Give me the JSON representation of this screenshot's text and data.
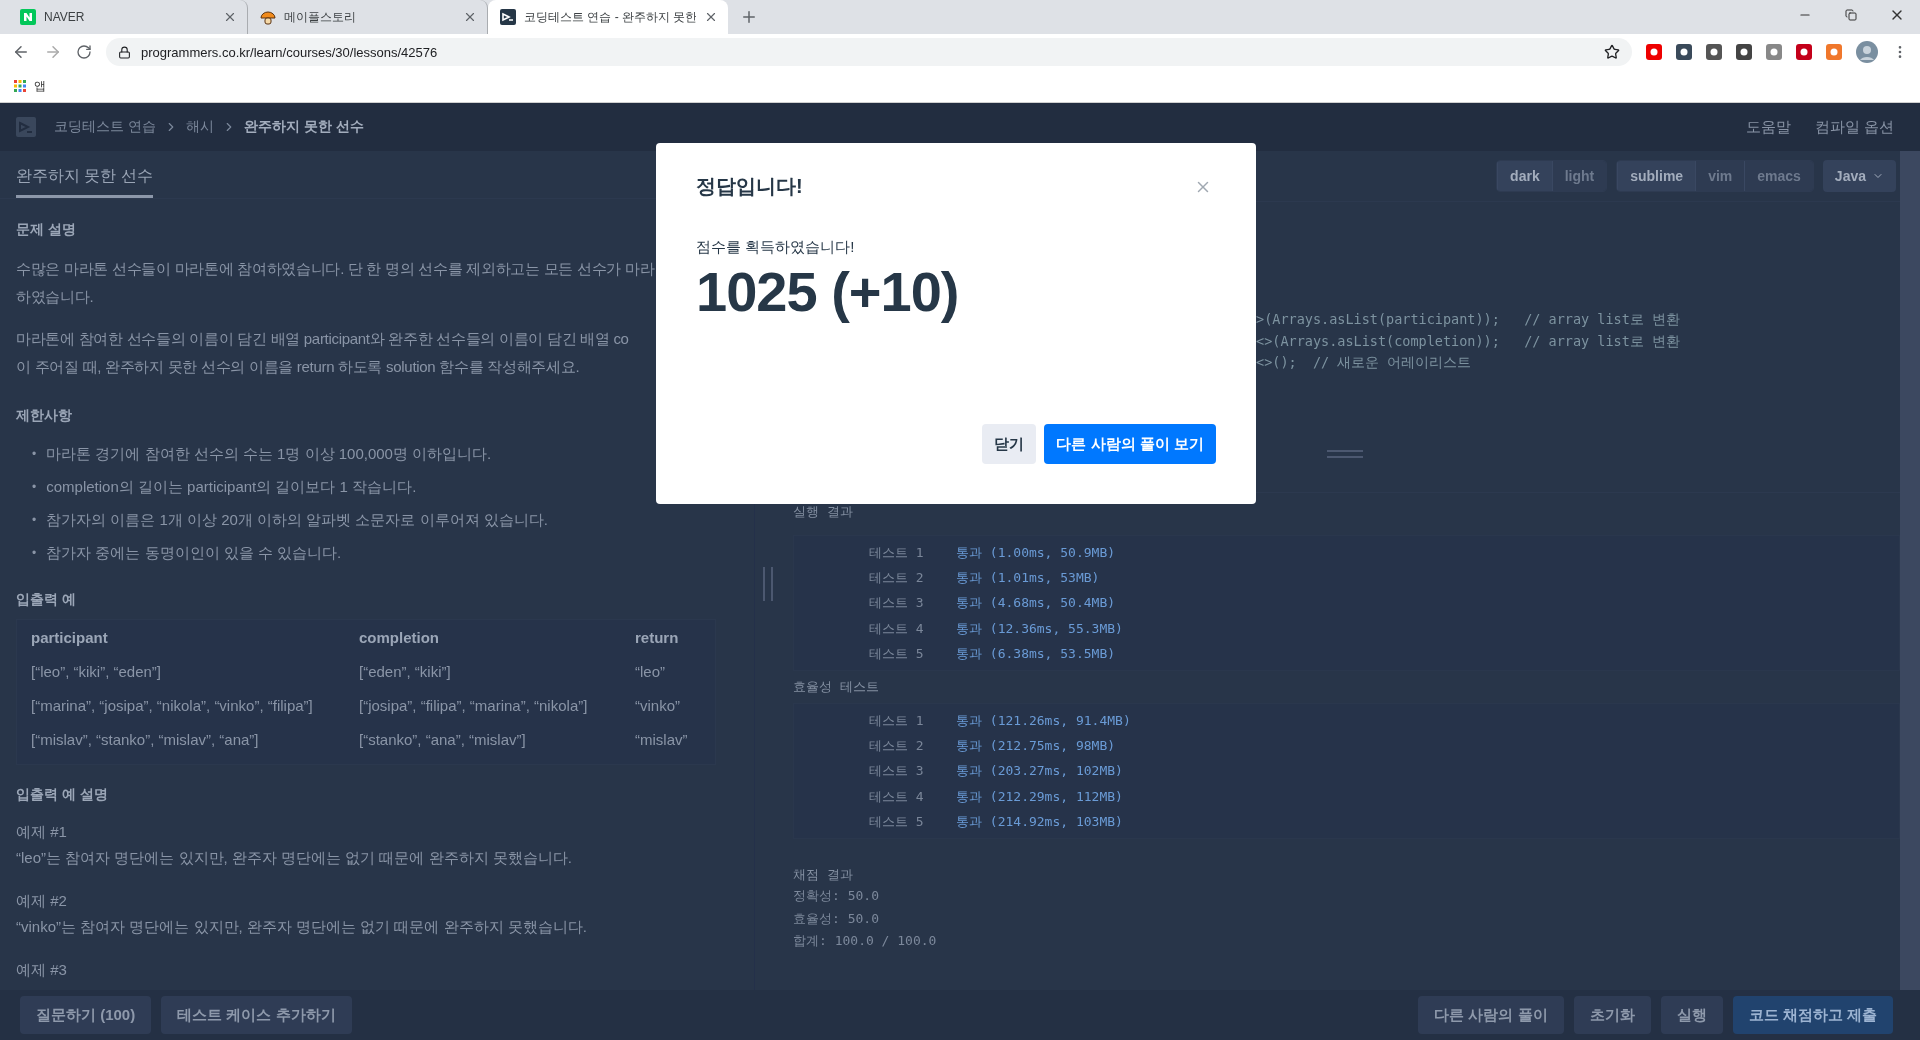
{
  "browser": {
    "tabs": [
      {
        "title": "NAVER",
        "kind": "naver",
        "selected": false
      },
      {
        "title": "메이플스토리",
        "kind": "maple",
        "selected": false
      },
      {
        "title": "코딩테스트 연습 - 완주하지 못한",
        "kind": "programmers",
        "selected": true
      }
    ],
    "url": "programmers.co.kr/learn/courses/30/lessons/42576",
    "bookmarks": [
      {
        "label": "앱"
      }
    ]
  },
  "header": {
    "breadcrumb": [
      "코딩테스트 연습",
      "해시",
      "완주하지 못한 선수"
    ],
    "links": [
      "도움말",
      "컴파일 옵션"
    ]
  },
  "problem_tabs": [
    {
      "label": "완주하지 못한 선수",
      "selected": true
    }
  ],
  "description": {
    "title": "문제 설명",
    "paragraphs": [
      [
        "수많은 마라톤 선수들이 마라톤에 참여하였습니다. 단 한 명의 선수를 제외하고는 모든 선수가 마라",
        "하였습니다."
      ],
      [
        "마라톤에 참여한 선수들의 이름이 담긴 배열 participant와 완주한 선수들의 이름이 담긴 배열 co",
        "이 주어질 때, 완주하지 못한 선수의 이름을 return 하도록 solution 함수를 작성해주세요."
      ]
    ]
  },
  "constraints": {
    "title": "제한사항",
    "marker": "•",
    "items": [
      "마라톤 경기에 참여한 선수의 수는 1명 이상 100,000명 이하입니다.",
      "completion의 길이는 participant의 길이보다 1 작습니다.",
      "참가자의 이름은 1개 이상 20개 이하의 알파벳 소문자로 이루어져 있습니다.",
      "참가자 중에는 동명이인이 있을 수 있습니다."
    ]
  },
  "examples": {
    "title": "입출력 예",
    "columns": [
      "participant",
      "completion",
      "return"
    ],
    "rows": [
      [
        "[“leo”, “kiki”, “eden”]",
        "[“eden”, “kiki”]",
        "“leo”"
      ],
      [
        "[“marina”, “josipa”, “nikola”, “vinko”, “filipa”]",
        "[“josipa”, “filipa”, “marina”, “nikola”]",
        "“vinko”"
      ],
      [
        "[“mislav”, “stanko”, “mislav”, “ana”]",
        "[“stanko”, “ana”, “mislav”]",
        "“mislav”"
      ]
    ]
  },
  "explanation": {
    "title": "입출력 예 설명",
    "items": [
      {
        "label": "예제 #1",
        "text": "“leo”는 참여자 명단에는 있지만, 완주자 명단에는 없기 때문에 완주하지 못했습니다."
      },
      {
        "label": "예제 #2",
        "text": "“vinko”는 참여자 명단에는 있지만, 완주자 명단에는 없기 때문에 완주하지 못했습니다."
      },
      {
        "label": "예제 #3"
      }
    ]
  },
  "editor": {
    "toggle_groups": [
      {
        "options": [
          {
            "label": "dark",
            "selected": true
          },
          {
            "label": "light",
            "selected": false
          }
        ]
      },
      {
        "options": [
          {
            "label": "sublime",
            "selected": true
          },
          {
            "label": "vim",
            "selected": false
          },
          {
            "label": "emacs",
            "selected": false
          }
        ]
      }
    ],
    "language": "Java",
    "code_lines": [
      ">(Arrays.asList(participant));   // array list로 변환",
      "<>(Arrays.asList(completion));   // array list로 변환",
      "<>();  // 새로운 어레이리스트"
    ]
  },
  "results": {
    "title": "실행 결과",
    "groups": [
      {
        "rows": [
          {
            "label": "테스트 1",
            "result": "통과 (1.00ms, 50.9MB)"
          },
          {
            "label": "테스트 2",
            "result": "통과 (1.01ms, 53MB)"
          },
          {
            "label": "테스트 3",
            "result": "통과 (4.68ms, 50.4MB)"
          },
          {
            "label": "테스트 4",
            "result": "통과 (12.36ms, 55.3MB)"
          },
          {
            "label": "테스트 5",
            "result": "통과 (6.38ms, 53.5MB)"
          }
        ]
      },
      {
        "title": "효율성  테스트",
        "rows": [
          {
            "label": "테스트 1",
            "result": "통과 (121.26ms, 91.4MB)"
          },
          {
            "label": "테스트 2",
            "result": "통과 (212.75ms, 98MB)"
          },
          {
            "label": "테스트 3",
            "result": "통과 (203.27ms, 102MB)"
          },
          {
            "label": "테스트 4",
            "result": "통과 (212.29ms, 112MB)"
          },
          {
            "label": "테스트 5",
            "result": "통과 (214.92ms, 103MB)"
          }
        ]
      }
    ],
    "summary": {
      "title": "채점 결과",
      "lines": [
        "정확성: 50.0",
        "효율성: 50.0",
        "합계: 100.0 / 100.0"
      ]
    }
  },
  "footer": {
    "left_buttons": [
      {
        "label": "질문하기 (100)",
        "kind": "secondary"
      },
      {
        "label": "테스트 케이스 추가하기",
        "kind": "secondary"
      }
    ],
    "right_buttons": [
      {
        "label": "다른 사람의 풀이",
        "kind": "secondary"
      },
      {
        "label": "초기화",
        "kind": "secondary"
      },
      {
        "label": "실행",
        "kind": "secondary"
      },
      {
        "label": "코드 채점하고 제출",
        "kind": "primary"
      }
    ]
  },
  "modal": {
    "title": "정답입니다!",
    "message": "점수를 획득하였습니다!",
    "score": "1025 (+10)",
    "buttons": [
      {
        "label": "닫기",
        "kind": "secondary"
      },
      {
        "label": "다른 사람의 풀이 보기",
        "kind": "primary"
      }
    ]
  }
}
